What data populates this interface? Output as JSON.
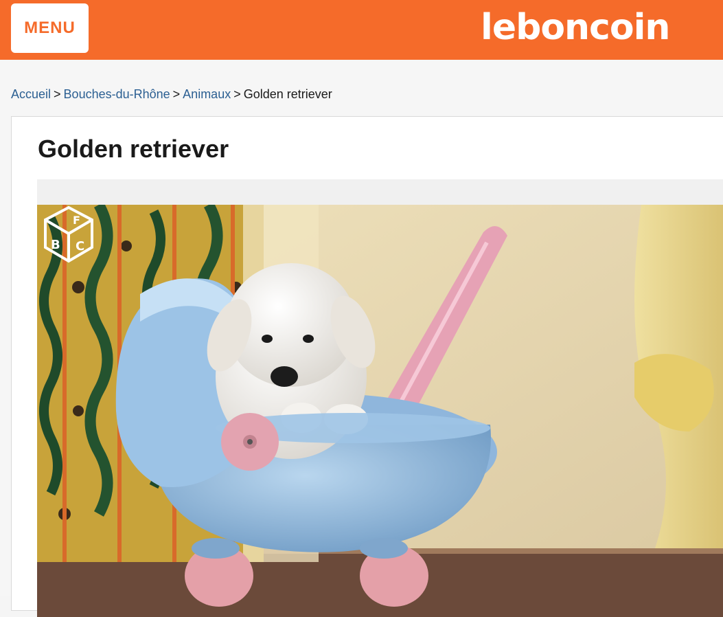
{
  "header": {
    "menu_label": "MENU",
    "logo_text": "leboncoin",
    "brand_color": "#f56b2a"
  },
  "breadcrumb": {
    "items": [
      "Accueil",
      "Bouches-du-Rhône",
      "Animaux"
    ],
    "separator": ">",
    "current": "Golden retriever"
  },
  "listing": {
    "title": "Golden retriever",
    "photo_badge_letters": [
      "F",
      "B",
      "C"
    ]
  }
}
